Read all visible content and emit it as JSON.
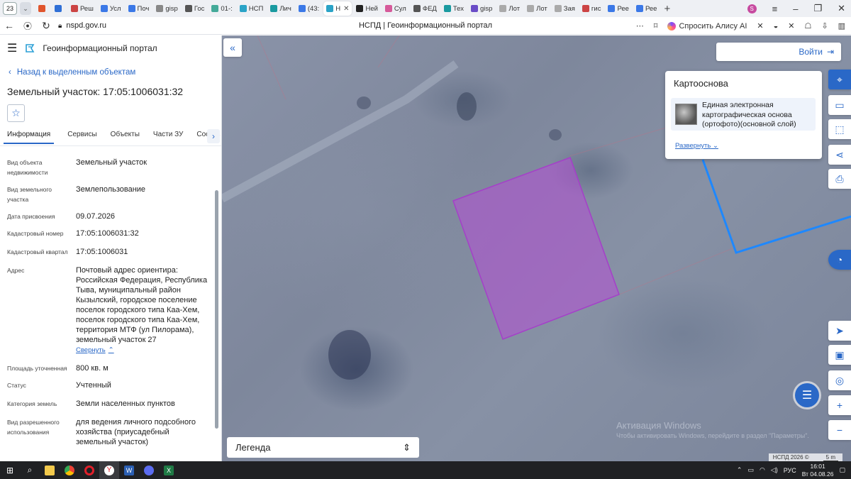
{
  "browser": {
    "tab_count": "23",
    "tabs": [
      {
        "label": "",
        "color": "#e0552d"
      },
      {
        "label": "",
        "color": "#2f6fd6"
      },
      {
        "label": "Реш",
        "color": "#c44"
      },
      {
        "label": "Усл",
        "color": "#3b78e7"
      },
      {
        "label": "Поч",
        "color": "#3b78e7"
      },
      {
        "label": "gisp",
        "color": "#888"
      },
      {
        "label": "Гос",
        "color": "#555"
      },
      {
        "label": "01-:",
        "color": "#4a9"
      },
      {
        "label": "НСП",
        "color": "#2aa3c7"
      },
      {
        "label": "Лич",
        "color": "#1a9aa0"
      },
      {
        "label": "(43:",
        "color": "#3b78e7"
      },
      {
        "label": "Н",
        "color": "#2aa3c7",
        "active": true
      },
      {
        "label": "Ней",
        "color": "#222"
      },
      {
        "label": "Сул",
        "color": "#d65a9a"
      },
      {
        "label": "ФЕД",
        "color": "#555"
      },
      {
        "label": "Тех",
        "color": "#1a9aa0"
      },
      {
        "label": "gisp",
        "color": "#6a4cc7"
      },
      {
        "label": "Лот",
        "color": "#aaa"
      },
      {
        "label": "Лот",
        "color": "#aaa"
      },
      {
        "label": "Зая",
        "color": "#aaa"
      },
      {
        "label": "гис",
        "color": "#c44"
      },
      {
        "label": "Рее",
        "color": "#3b78e7"
      },
      {
        "label": "Рее",
        "color": "#3b78e7"
      }
    ],
    "profile_initial": "S",
    "url": "nspd.gov.ru",
    "page_title": "НСПД | Геоинформационный портал",
    "alisa_label": "Спросить Алису AI"
  },
  "sidebar": {
    "portal_name": "Геоинформационный портал",
    "back_label": "Назад к выделенным объектам",
    "object_title": "Земельный участок: 17:05:1006031:32",
    "tabs": [
      "Информация",
      "Сервисы",
      "Объекты",
      "Части ЗУ",
      "Состав"
    ],
    "properties": [
      {
        "key": "Вид объекта недвижимости",
        "value": "Земельный участок"
      },
      {
        "key": "Вид земельного участка",
        "value": "Землепользование"
      },
      {
        "key": "Дата присвоения",
        "value": "09.07.2026"
      },
      {
        "key": "Кадастровый номер",
        "value": "17:05:1006031:32"
      },
      {
        "key": "Кадастровый квартал",
        "value": "17:05:1006031"
      },
      {
        "key": "Адрес",
        "value": "Почтовый адрес ориентира: Российская Федерация, Республика Тыва, муниципальный район Кызылский, городское поселение поселок городского типа Каа-Хем, поселок городского типа Каа-Хем, территория МТФ (ул Пилорама), земельный участок 27"
      },
      {
        "key": "Площадь уточненная",
        "value": "800 кв. м"
      },
      {
        "key": "Статус",
        "value": "Учтенный"
      },
      {
        "key": "Категория земель",
        "value": "Земли населенных пунктов"
      },
      {
        "key": "Вид разрешенного использования",
        "value": "для ведения личного подсобного хозяйства (приусадебный земельный участок)"
      }
    ],
    "collapse_label": "Свернуть"
  },
  "map": {
    "login_label": "Войти",
    "basemap_title": "Картооснова",
    "basemap_item": "Единая электронная картографическая основа (ортофото)(основной слой)",
    "expand_label": "Развернуть",
    "legend_label": "Легенда",
    "watermark_title": "Активация Windows",
    "watermark_text": "Чтобы активировать Windows, перейдите в раздел \"Параметры\".",
    "copyright": "НСПД 2026 ©",
    "scale": "5 m",
    "colors": {
      "parcel_fill": "#b44fd6",
      "parcel_stroke": "#a53fc9",
      "neighbor_stroke": "#1e88ff",
      "accent": "#2a68c7"
    }
  },
  "taskbar": {
    "language": "РУС",
    "time": "16:01",
    "date": "Вт 04.08.26"
  }
}
